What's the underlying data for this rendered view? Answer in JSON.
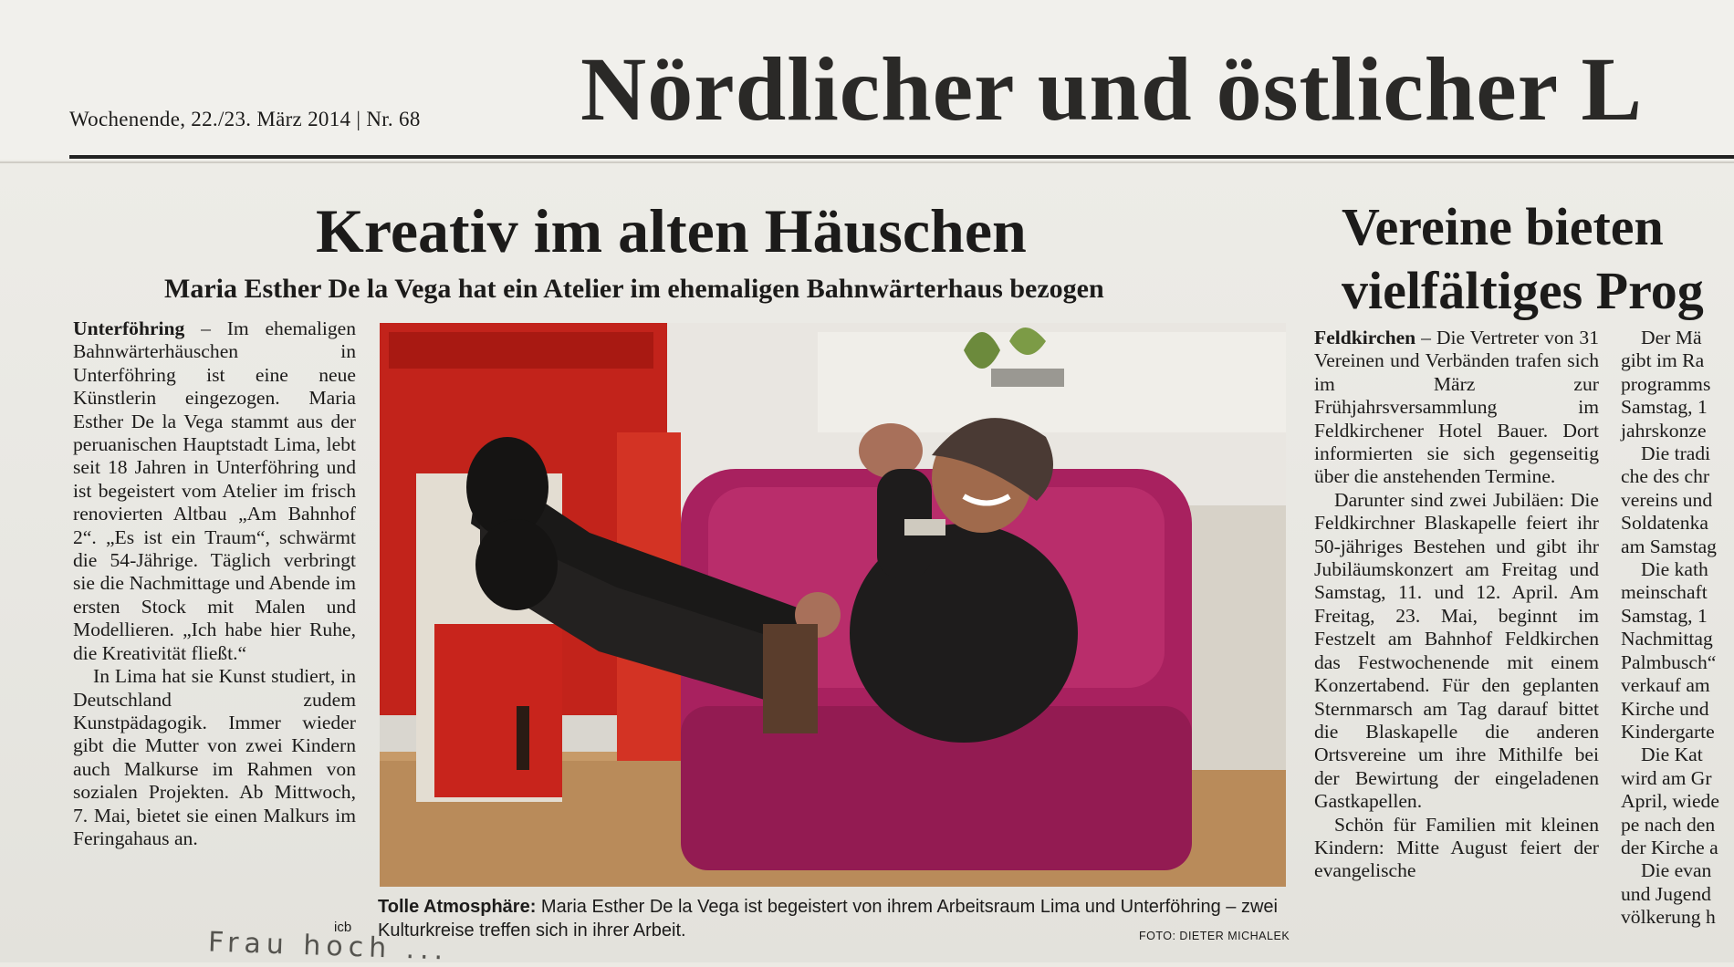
{
  "page": {
    "dateline": "Wochenende, 22./23. März 2014 | Nr. 68",
    "masthead": "Nördlicher und östlicher L"
  },
  "article": {
    "headline": "Kreativ im alten Häuschen",
    "subhead": "Maria Esther De la Vega hat ein Atelier im ehemaligen Bahnwärterhaus bezogen",
    "lead_place": "Unterföhring",
    "para1": "– Im ehemaligen Bahnwärterhäuschen in Unterföhring ist eine neue Künstlerin eingezogen. Maria Esther De la Vega stammt aus der peruanischen Hauptstadt Lima, lebt seit 18 Jahren in Unterföhring und ist begeistert vom Atelier im frisch renovierten Altbau „Am Bahnhof 2“. „Es ist ein Traum“, schwärmt die 54-Jährige. Täglich verbringt sie die Nachmittage und Abende im ersten Stock mit Malen und Modellieren. „Ich habe hier Ruhe, die Kreativität fließt.“",
    "para2": "In Lima hat sie Kunst studiert, in Deutschland zudem Kunstpädagogik. Immer wieder gibt die Mutter von zwei Kindern auch Malkurse im Rahmen von sozialen Projekten. Ab Mittwoch, 7. Mai, bietet sie einen Malkurs im Feringahaus an.",
    "signature": "icb",
    "caption_label": "Tolle Atmosphäre:",
    "caption_text": "Maria Esther De la Vega ist begeistert von ihrem Arbeitsraum Lima und Unterföhring – zwei Kulturkreise treffen sich in ihrer Arbeit.",
    "photo_credit": "FOTO: DIETER MICHALEK"
  },
  "article2": {
    "headline_line1": "Vereine bieten",
    "headline_line2": "vielfältiges Prog",
    "lead_place": "Feldkirchen",
    "para1": "– Die Vertreter von 31 Vereinen und Verbänden trafen sich im März zur Frühjahrsversammlung im Feldkirchener Hotel Bauer. Dort informierten sie sich gegenseitig über die anstehenden Termine.",
    "para2": "Darunter sind zwei Jubiläen: Die Feldkirchner Blaskapelle feiert ihr 50-jähriges Bestehen und gibt ihr Jubiläumskonzert am Freitag und Samstag, 11. und 12. April. Am Freitag, 23. Mai, beginnt im Festzelt am Bahnhof Feldkirchen das Festwochenende mit einem Konzertabend. Für den geplanten Sternmarsch am Tag darauf bittet die Blaskapelle die anderen Ortsvereine um ihre Mithilfe bei der Bewirtung der eingeladenen Gastkapellen.",
    "para3": "Schön für Familien mit kleinen Kindern: Mitte August feiert der evangelische"
  },
  "column3": {
    "lines": [
      "Der Mä",
      "gibt im Ra",
      "programms",
      "Samstag, 1",
      "jahrskonze",
      "Die tradi",
      "che des chr",
      "vereins und",
      "Soldatenka",
      "am Samstag",
      "Die kath",
      "meinschaft",
      "Samstag, 1",
      "Nachmittag",
      "Palmbusch“",
      "verkauf am",
      "Kirche und",
      "Kindergarte",
      "Die Kat",
      "wird am Gr",
      "April, wiede",
      "pe nach den",
      "der Kirche a",
      "Die evan",
      "und Jugend",
      "völkerung h"
    ]
  },
  "handwriting": "Frau hoch ...",
  "colors": {
    "accent_red": "#c8241c",
    "chair_magenta": "#a8215f",
    "rule": "#222222"
  }
}
